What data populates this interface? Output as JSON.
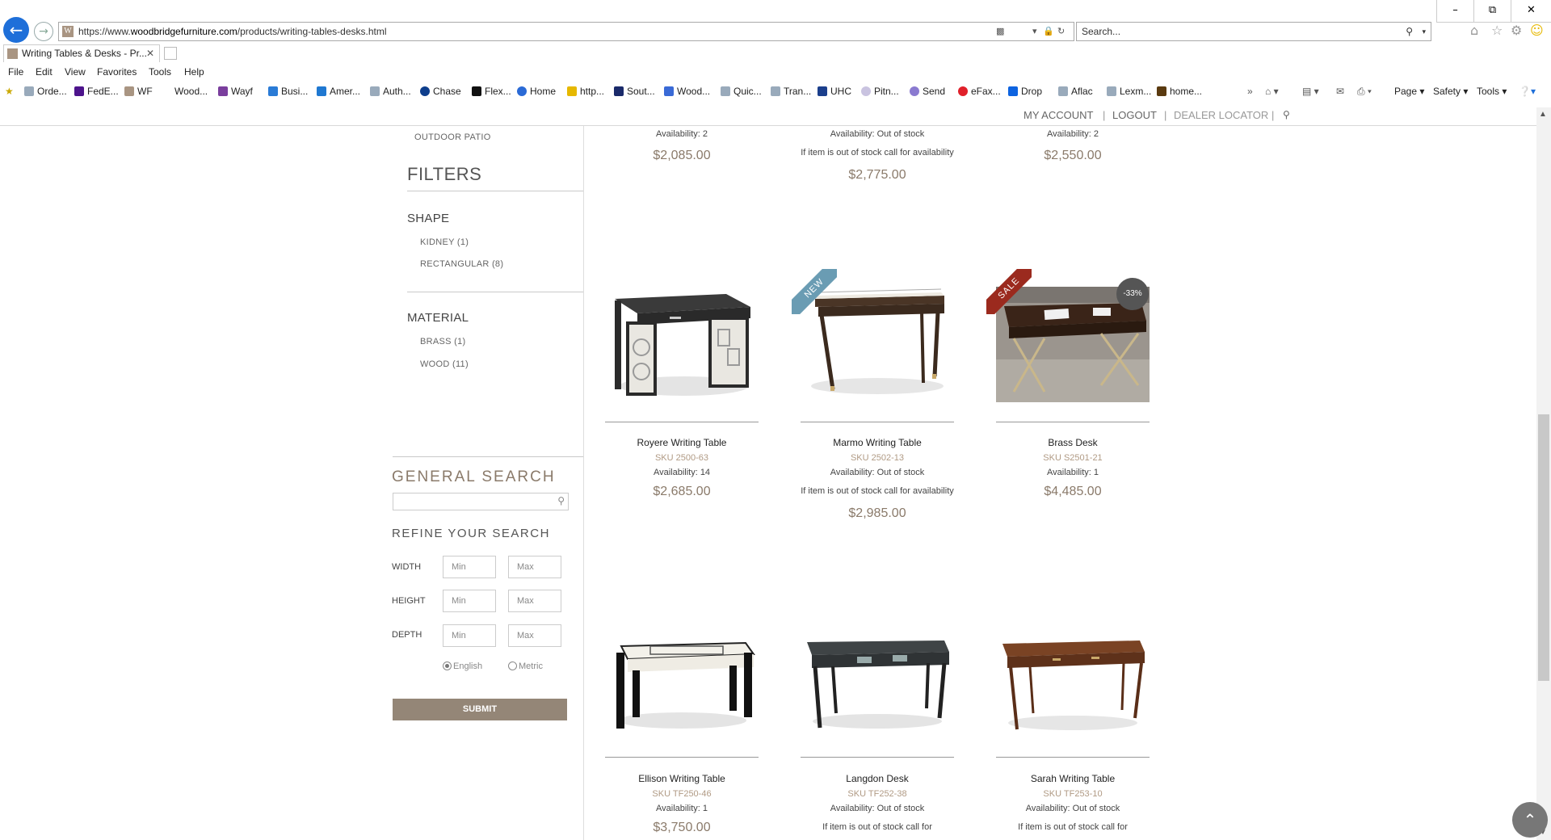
{
  "browser": {
    "url_prefix": "https://www.",
    "url_domain": "woodbridgefurniture.com",
    "url_path": "/products/writing-tables-desks.html",
    "search_placeholder": "Search...",
    "tab_title": "Writing Tables & Desks - Pr...",
    "menu": [
      "File",
      "Edit",
      "View",
      "Favorites",
      "Tools",
      "Help"
    ],
    "favorites": [
      "Orde...",
      "FedE...",
      "WF",
      "Wood...",
      "Wayf",
      "Busi...",
      "Amer...",
      "Auth...",
      "Chase",
      "Flex...",
      "Home",
      "http...",
      "Sout...",
      "Wood...",
      "Quic...",
      "Tran...",
      "UHC",
      "Pitn...",
      "Send",
      "eFax...",
      "Drop",
      "Aflac",
      "Lexm...",
      "home..."
    ],
    "commands": [
      "Page",
      "Safety",
      "Tools"
    ]
  },
  "site_nav": {
    "my_account": "MY ACCOUNT",
    "logout": "LOGOUT",
    "dealer_locator": "DEALER LOCATOR"
  },
  "sidebar": {
    "outdoor_patio": "OUTDOOR PATIO",
    "filters_title": "FILTERS",
    "shape_title": "SHAPE",
    "shape_options": [
      "KIDNEY (1)",
      "RECTANGULAR (8)"
    ],
    "material_title": "MATERIAL",
    "material_options": [
      "BRASS (1)",
      "WOOD (11)"
    ],
    "general_search": "GENERAL SEARCH",
    "refine": "REFINE YOUR SEARCH",
    "dims": [
      "WIDTH",
      "HEIGHT",
      "DEPTH"
    ],
    "min": "Min",
    "max": "Max",
    "english": "English",
    "metric": "Metric",
    "submit": "SUBMIT"
  },
  "top_row": [
    {
      "availability": "Availability: 2",
      "price": "$2,085.00"
    },
    {
      "availability": "Availability: Out of stock",
      "note": "If item is out of stock call for availability",
      "price": "$2,775.00"
    },
    {
      "availability": "Availability: 2",
      "price": "$2,550.00"
    }
  ],
  "products": [
    {
      "name": "Royere Writing Table",
      "sku": "SKU 2500-63",
      "availability": "Availability: 14",
      "price": "$2,685.00"
    },
    {
      "name": "Marmo Writing Table",
      "sku": "SKU 2502-13",
      "availability": "Availability: Out of stock",
      "note": "If item is out of stock call for availability",
      "price": "$2,985.00",
      "ribbon": "NEW"
    },
    {
      "name": "Brass Desk",
      "sku": "SKU S2501-21",
      "availability": "Availability: 1",
      "price": "$4,485.00",
      "ribbon": "SALE",
      "badge": "-33%"
    },
    {
      "name": "Ellison Writing Table",
      "sku": "SKU TF250-46",
      "availability": "Availability: 1",
      "price": "$3,750.00"
    },
    {
      "name": "Langdon Desk",
      "sku": "SKU TF252-38",
      "availability": "Availability: Out of stock",
      "note": "If item is out of stock call for"
    },
    {
      "name": "Sarah Writing Table",
      "sku": "SKU TF253-10",
      "availability": "Availability: Out of stock",
      "note": "If item is out of stock call for"
    }
  ],
  "colors": {
    "accent": "#948677",
    "sku": "#b09a84",
    "new_ribbon": "#6a9cb3",
    "sale_ribbon": "#9b2a1e"
  }
}
